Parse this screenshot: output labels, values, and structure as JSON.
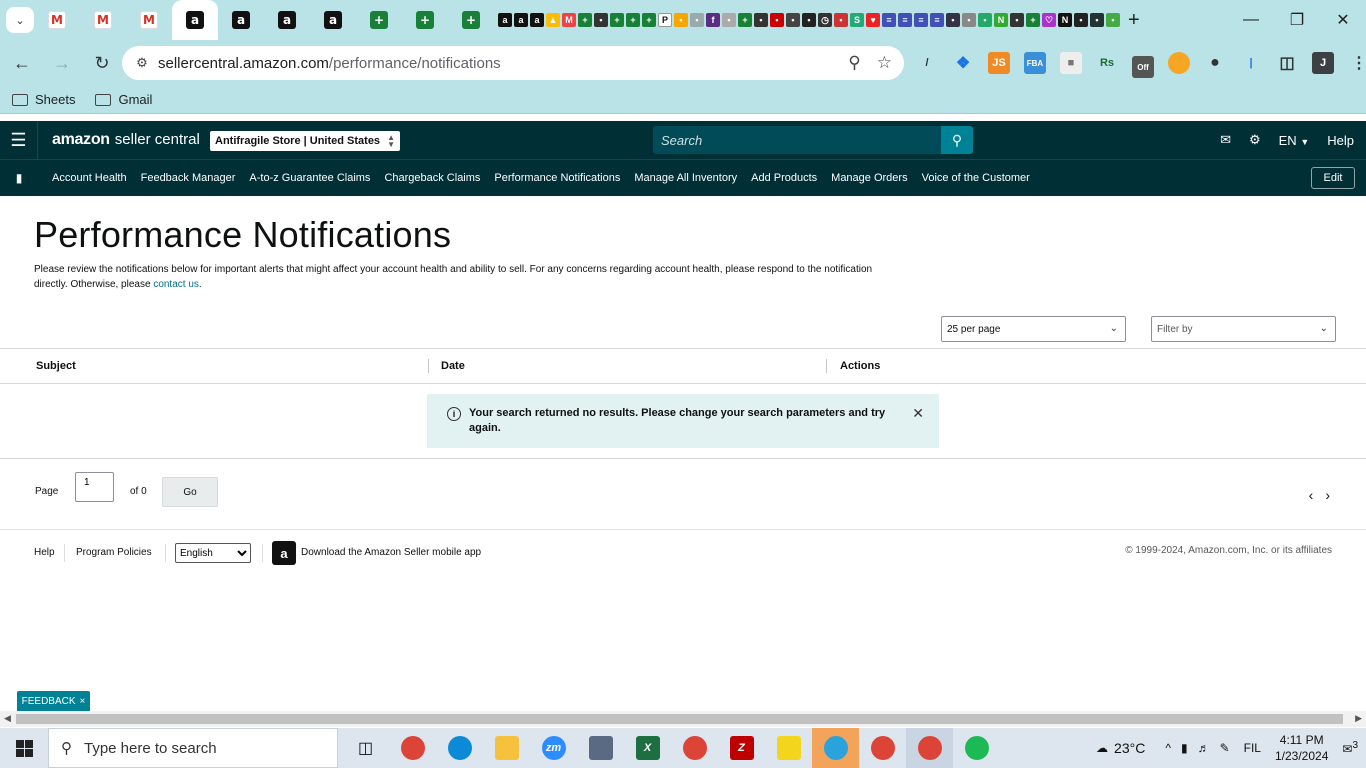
{
  "browser": {
    "url_domain": "sellercentral.amazon.com",
    "url_path": "/performance/notifications",
    "bookmarks": [
      "Sheets",
      "Gmail"
    ],
    "profile_initial": "J",
    "ext_js": "JS",
    "ext_fba": "FBA",
    "ext_rs": "Rs",
    "ext_off": "Off"
  },
  "header": {
    "logo_brand": "amazon",
    "logo_suffix": "seller central",
    "store_selector": "Antifragile Store | United States",
    "search_placeholder": "Search",
    "language": "EN",
    "help": "Help"
  },
  "nav": {
    "items": [
      "Account Health",
      "Feedback Manager",
      "A-to-z Guarantee Claims",
      "Chargeback Claims",
      "Performance Notifications",
      "Manage All Inventory",
      "Add Products",
      "Manage Orders",
      "Voice of the Customer"
    ],
    "edit": "Edit"
  },
  "page": {
    "title": "Performance Notifications",
    "description": "Please review the notifications below for important alerts that might affect your account health and ability to sell. For any concerns regarding account health, please respond to the notification directly. Otherwise, please",
    "contact_link": "contact us",
    "contact_suffix": ".",
    "per_page": "25 per page",
    "filter_placeholder": "Filter by"
  },
  "table": {
    "columns": [
      "Subject",
      "Date",
      "Actions"
    ],
    "empty_message": "Your search returned no results. Please change your search parameters and try again."
  },
  "pager": {
    "page_label": "Page",
    "page_value": "1",
    "of_label": "of 0",
    "go_label": "Go"
  },
  "footer": {
    "help": "Help",
    "program_policies": "Program Policies",
    "language_options": [
      "English"
    ],
    "app_text": "Download the Amazon Seller mobile app",
    "copyright": "© 1999-2024, Amazon.com, Inc. or its affiliates",
    "feedback": "FEEDBACK"
  },
  "taskbar": {
    "search_placeholder": "Type here to search",
    "weather": "23°C",
    "language": "FIL",
    "time": "4:11 PM",
    "date": "1/23/2024",
    "notification_count": "3",
    "zoom_label": "zm"
  }
}
